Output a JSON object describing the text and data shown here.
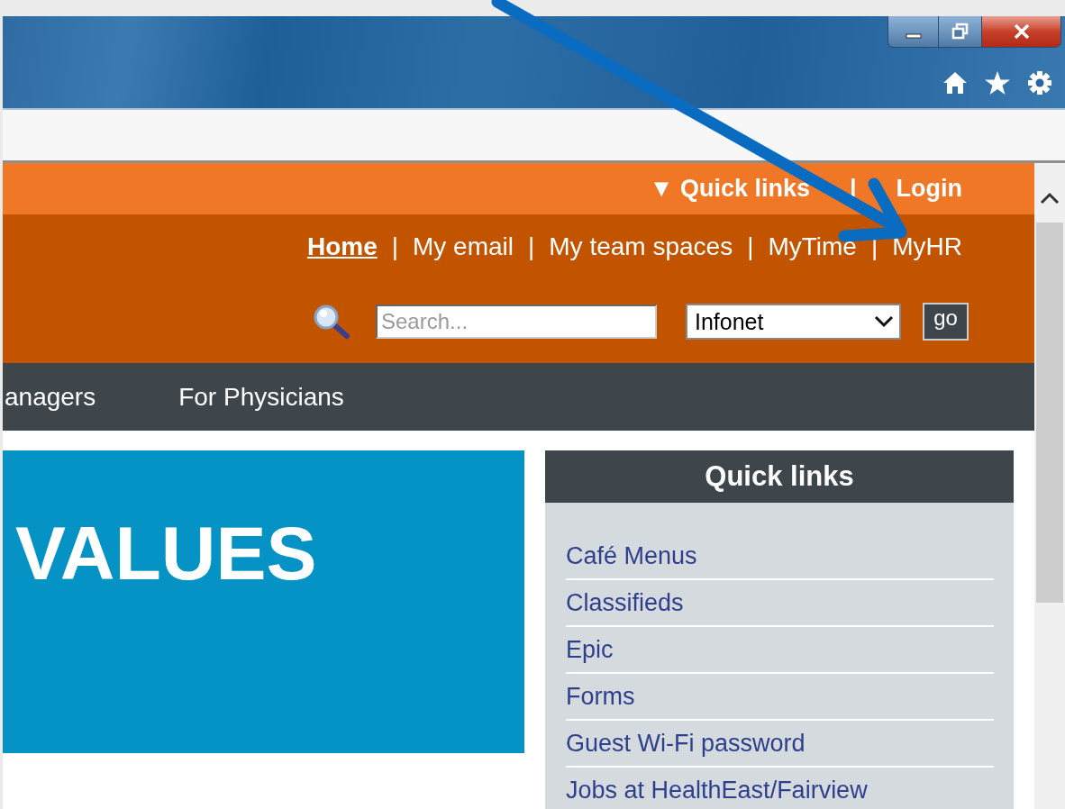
{
  "utility_links": [
    {
      "caret": "▼",
      "label": "Quick links"
    },
    {
      "separator": "|",
      "label": "Login"
    }
  ],
  "main_links": [
    {
      "label": "Home",
      "selected": true
    },
    {
      "separator": "|",
      "label": "My email",
      "selected": false
    },
    {
      "separator": "|",
      "label": "My team spaces",
      "selected": false
    },
    {
      "separator": "|",
      "label": "MyTime",
      "selected": false
    },
    {
      "separator": "|",
      "label": "MyHR",
      "selected": false
    }
  ],
  "search": {
    "placeholder": "Search...",
    "scope": "Infonet",
    "button": "go"
  },
  "nav": [
    "anagers",
    "For Physicians"
  ],
  "hero": {
    "title": "VALUES"
  },
  "quick_links": {
    "title": "Quick links",
    "items": [
      "Café Menus",
      "Classifieds",
      "Epic",
      "Forms",
      "Guest Wi-Fi password",
      "Jobs at HealthEast/Fairview"
    ]
  }
}
